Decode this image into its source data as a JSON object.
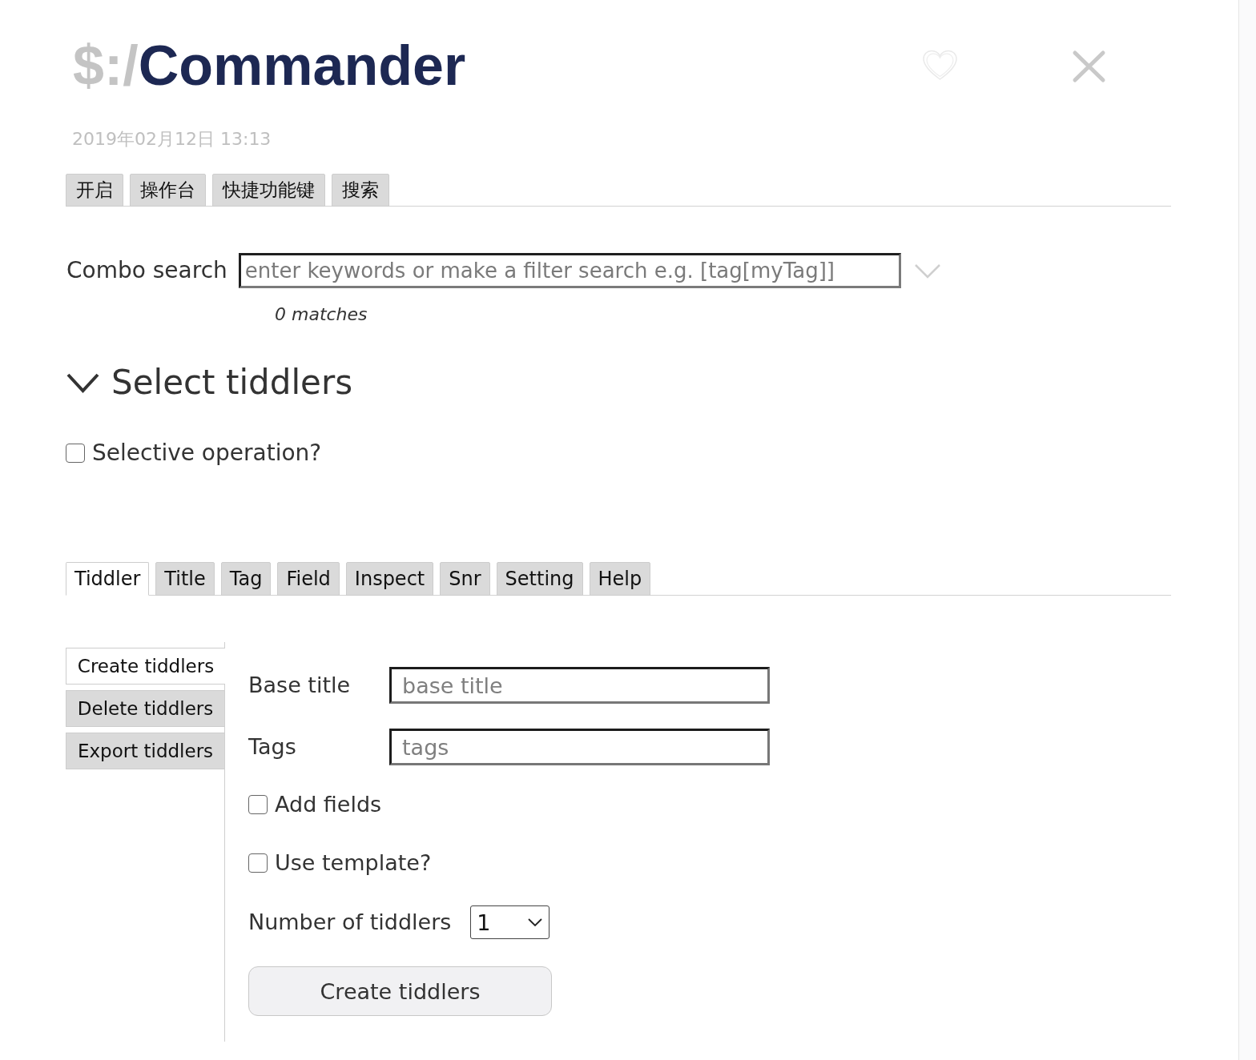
{
  "tiddler": {
    "title_prefix": "$:/",
    "title": "Commander",
    "date": "2019年02月12日 13:13"
  },
  "top_tabs": [
    {
      "label": "开启",
      "selected": false
    },
    {
      "label": "操作台",
      "selected": false
    },
    {
      "label": "快捷功能键",
      "selected": false
    },
    {
      "label": "搜索",
      "selected": false
    }
  ],
  "combo_search": {
    "label": "Combo search",
    "placeholder": "enter keywords or make a filter search e.g. [tag[myTag]]",
    "matches": "0 matches"
  },
  "select_section": {
    "heading": "Select tiddlers",
    "expanded": true,
    "selective_operation": {
      "label": "Selective operation?",
      "checked": false
    }
  },
  "tabs": [
    {
      "label": "Tiddler",
      "selected": true
    },
    {
      "label": "Title",
      "selected": false
    },
    {
      "label": "Tag",
      "selected": false
    },
    {
      "label": "Field",
      "selected": false
    },
    {
      "label": "Inspect",
      "selected": false
    },
    {
      "label": "Snr",
      "selected": false
    },
    {
      "label": "Setting",
      "selected": false
    },
    {
      "label": "Help",
      "selected": false
    }
  ],
  "create": {
    "side_tabs": [
      {
        "label": "Create tiddlers",
        "selected": true
      },
      {
        "label": "Delete tiddlers",
        "selected": false
      },
      {
        "label": "Export tiddlers",
        "selected": false
      }
    ],
    "fields": [
      {
        "label": "Base title",
        "placeholder": "base title"
      },
      {
        "label": "Tags",
        "placeholder": "tags"
      }
    ],
    "options": [
      {
        "label": "Add fields",
        "checked": false
      },
      {
        "label": "Use template?",
        "checked": false
      }
    ],
    "count": {
      "label": "Number of tiddlers",
      "value": "1"
    },
    "button": "Create tiddlers"
  }
}
